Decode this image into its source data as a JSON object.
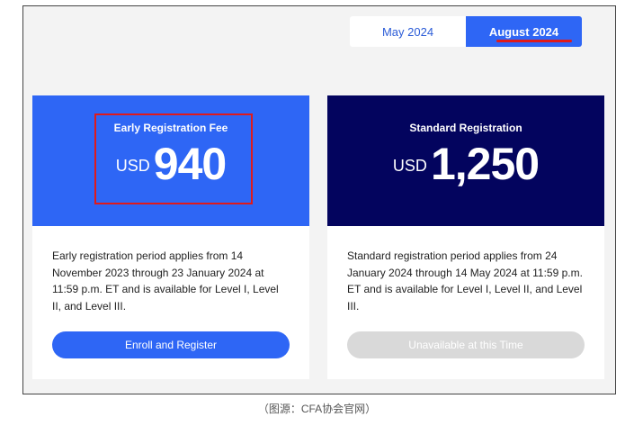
{
  "tabs": [
    {
      "label": "May 2024",
      "active": false
    },
    {
      "label": "August 2024",
      "active": true
    }
  ],
  "cards": [
    {
      "title": "Early Registration Fee",
      "currency": "USD",
      "amount": "940",
      "description": "Early registration period applies from 14 November 2023 through 23 January 2024 at 11:59 p.m. ET and is available for Level I, Level II, and Level III.",
      "button": "Enroll and Register"
    },
    {
      "title": "Standard Registration",
      "currency": "USD",
      "amount": "1,250",
      "description": "Standard registration period applies from 24 January 2024 through 14 May 2024 at 11:59 p.m. ET and is available for Level I, Level II, and Level III.",
      "button": "Unavailable at this Time"
    }
  ],
  "caption": "（图源：CFA协会官网）",
  "colors": {
    "primary_blue": "#2e66f5",
    "navy": "#03045e",
    "highlight_red": "#e01a1a",
    "disabled_gray": "#d9d9d9"
  }
}
